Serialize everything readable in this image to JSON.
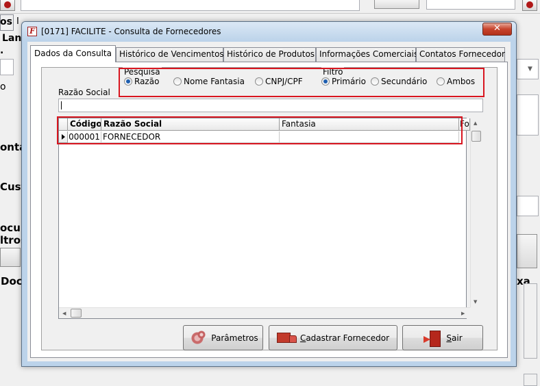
{
  "window": {
    "title": "[0171] FACILITE - Consulta de Fornecedores",
    "close_glyph": "✕"
  },
  "tabs": [
    {
      "label": "Dados da Consulta",
      "active": true
    },
    {
      "label": "Histórico de Vencimentos",
      "active": false
    },
    {
      "label": "Histórico de Produtos",
      "active": false
    },
    {
      "label": "Informações Comerciais",
      "active": false
    },
    {
      "label": "Contatos Fornecedor",
      "active": false
    }
  ],
  "pesquisa": {
    "title": "Pesquisa",
    "options": [
      {
        "label": "Razão",
        "selected": true
      },
      {
        "label": "Nome Fantasia",
        "selected": false
      },
      {
        "label": "CNPJ/CPF",
        "selected": false
      }
    ]
  },
  "filtro": {
    "title": "Filtro",
    "options": [
      {
        "label": "Primário",
        "selected": true
      },
      {
        "label": "Secundário",
        "selected": false
      },
      {
        "label": "Ambos",
        "selected": false
      }
    ]
  },
  "search": {
    "label": "Razão Social",
    "value": ""
  },
  "grid": {
    "columns": [
      "Código",
      "Razão Social",
      "Fantasia",
      "Fo"
    ],
    "rows": [
      {
        "codigo": "000001",
        "razao_social": "FORNECEDOR",
        "fantasia": ""
      }
    ]
  },
  "buttons": {
    "parametros": {
      "label": "Parâmetros",
      "icon": "gears-icon"
    },
    "cadastrar": {
      "label_underlined": "C",
      "label_rest": "adastrar Fornecedor",
      "icon": "truck-icon"
    },
    "sair": {
      "label_underlined": "S",
      "label_rest": "air",
      "icon": "exit-door-icon"
    }
  },
  "background": {
    "fragments": [
      "os",
      "Lan",
      ".",
      "o",
      "onta",
      "Cust",
      "ocun",
      "ltros",
      "Doc",
      "xa",
      "I"
    ]
  },
  "colors": {
    "highlight": "#d8151f",
    "radio_selected": "#1f5fb0",
    "close_button": "#c7432c"
  }
}
